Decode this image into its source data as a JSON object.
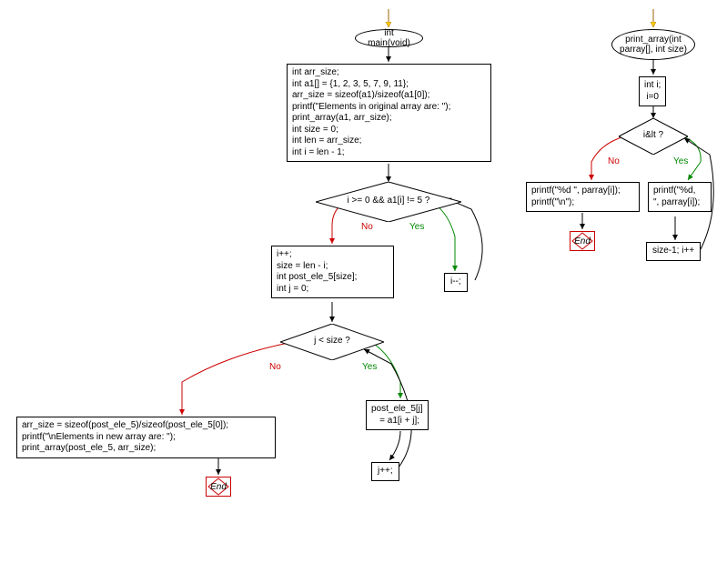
{
  "flowchart": {
    "main": {
      "start_label": "int main(void)",
      "init_block": "int arr_size;\nint a1[] = {1, 2, 3, 5, 7, 9, 11};\narr_size = sizeof(a1)/sizeof(a1[0]);\nprintf(\"Elements in original array are: \");\nprint_array(a1, arr_size);\nint size = 0;\nint len = arr_size;\nint i = len - 1;",
      "cond1": "i >= 0 && a1[i] != 5 ?",
      "cond1_yes_body": "i--;",
      "cond1_no_block": "i++;\nsize = len - i;\nint post_ele_5[size];\nint j = 0;",
      "cond2": "j < size ?",
      "cond2_yes_body": "post_ele_5[j]\n  = a1[i + j];",
      "cond2_yes_after": "j++;",
      "cond2_no_block": "arr_size = sizeof(post_ele_5)/sizeof(post_ele_5[0]);\nprintf(\"\\nElements in new array are: \");\nprint_array(post_ele_5, arr_size);",
      "end_label": "End"
    },
    "print_array": {
      "start_label": "print_array(int\nparray[], int size)",
      "init_block": "int i;\ni=0",
      "cond": "i&lt ?",
      "cond_yes_body": "printf(\"%d,\n\", parray[i]);",
      "cond_yes_after": "size-1; i++",
      "cond_no_block": "printf(\"%d \", parray[i]);\nprintf(\"\\n\");",
      "end_label": "End"
    },
    "labels": {
      "yes": "Yes",
      "no": "No"
    }
  },
  "colors": {
    "yes": "#008000",
    "no": "#cc0000",
    "arrow_start": "#ffcc00"
  }
}
